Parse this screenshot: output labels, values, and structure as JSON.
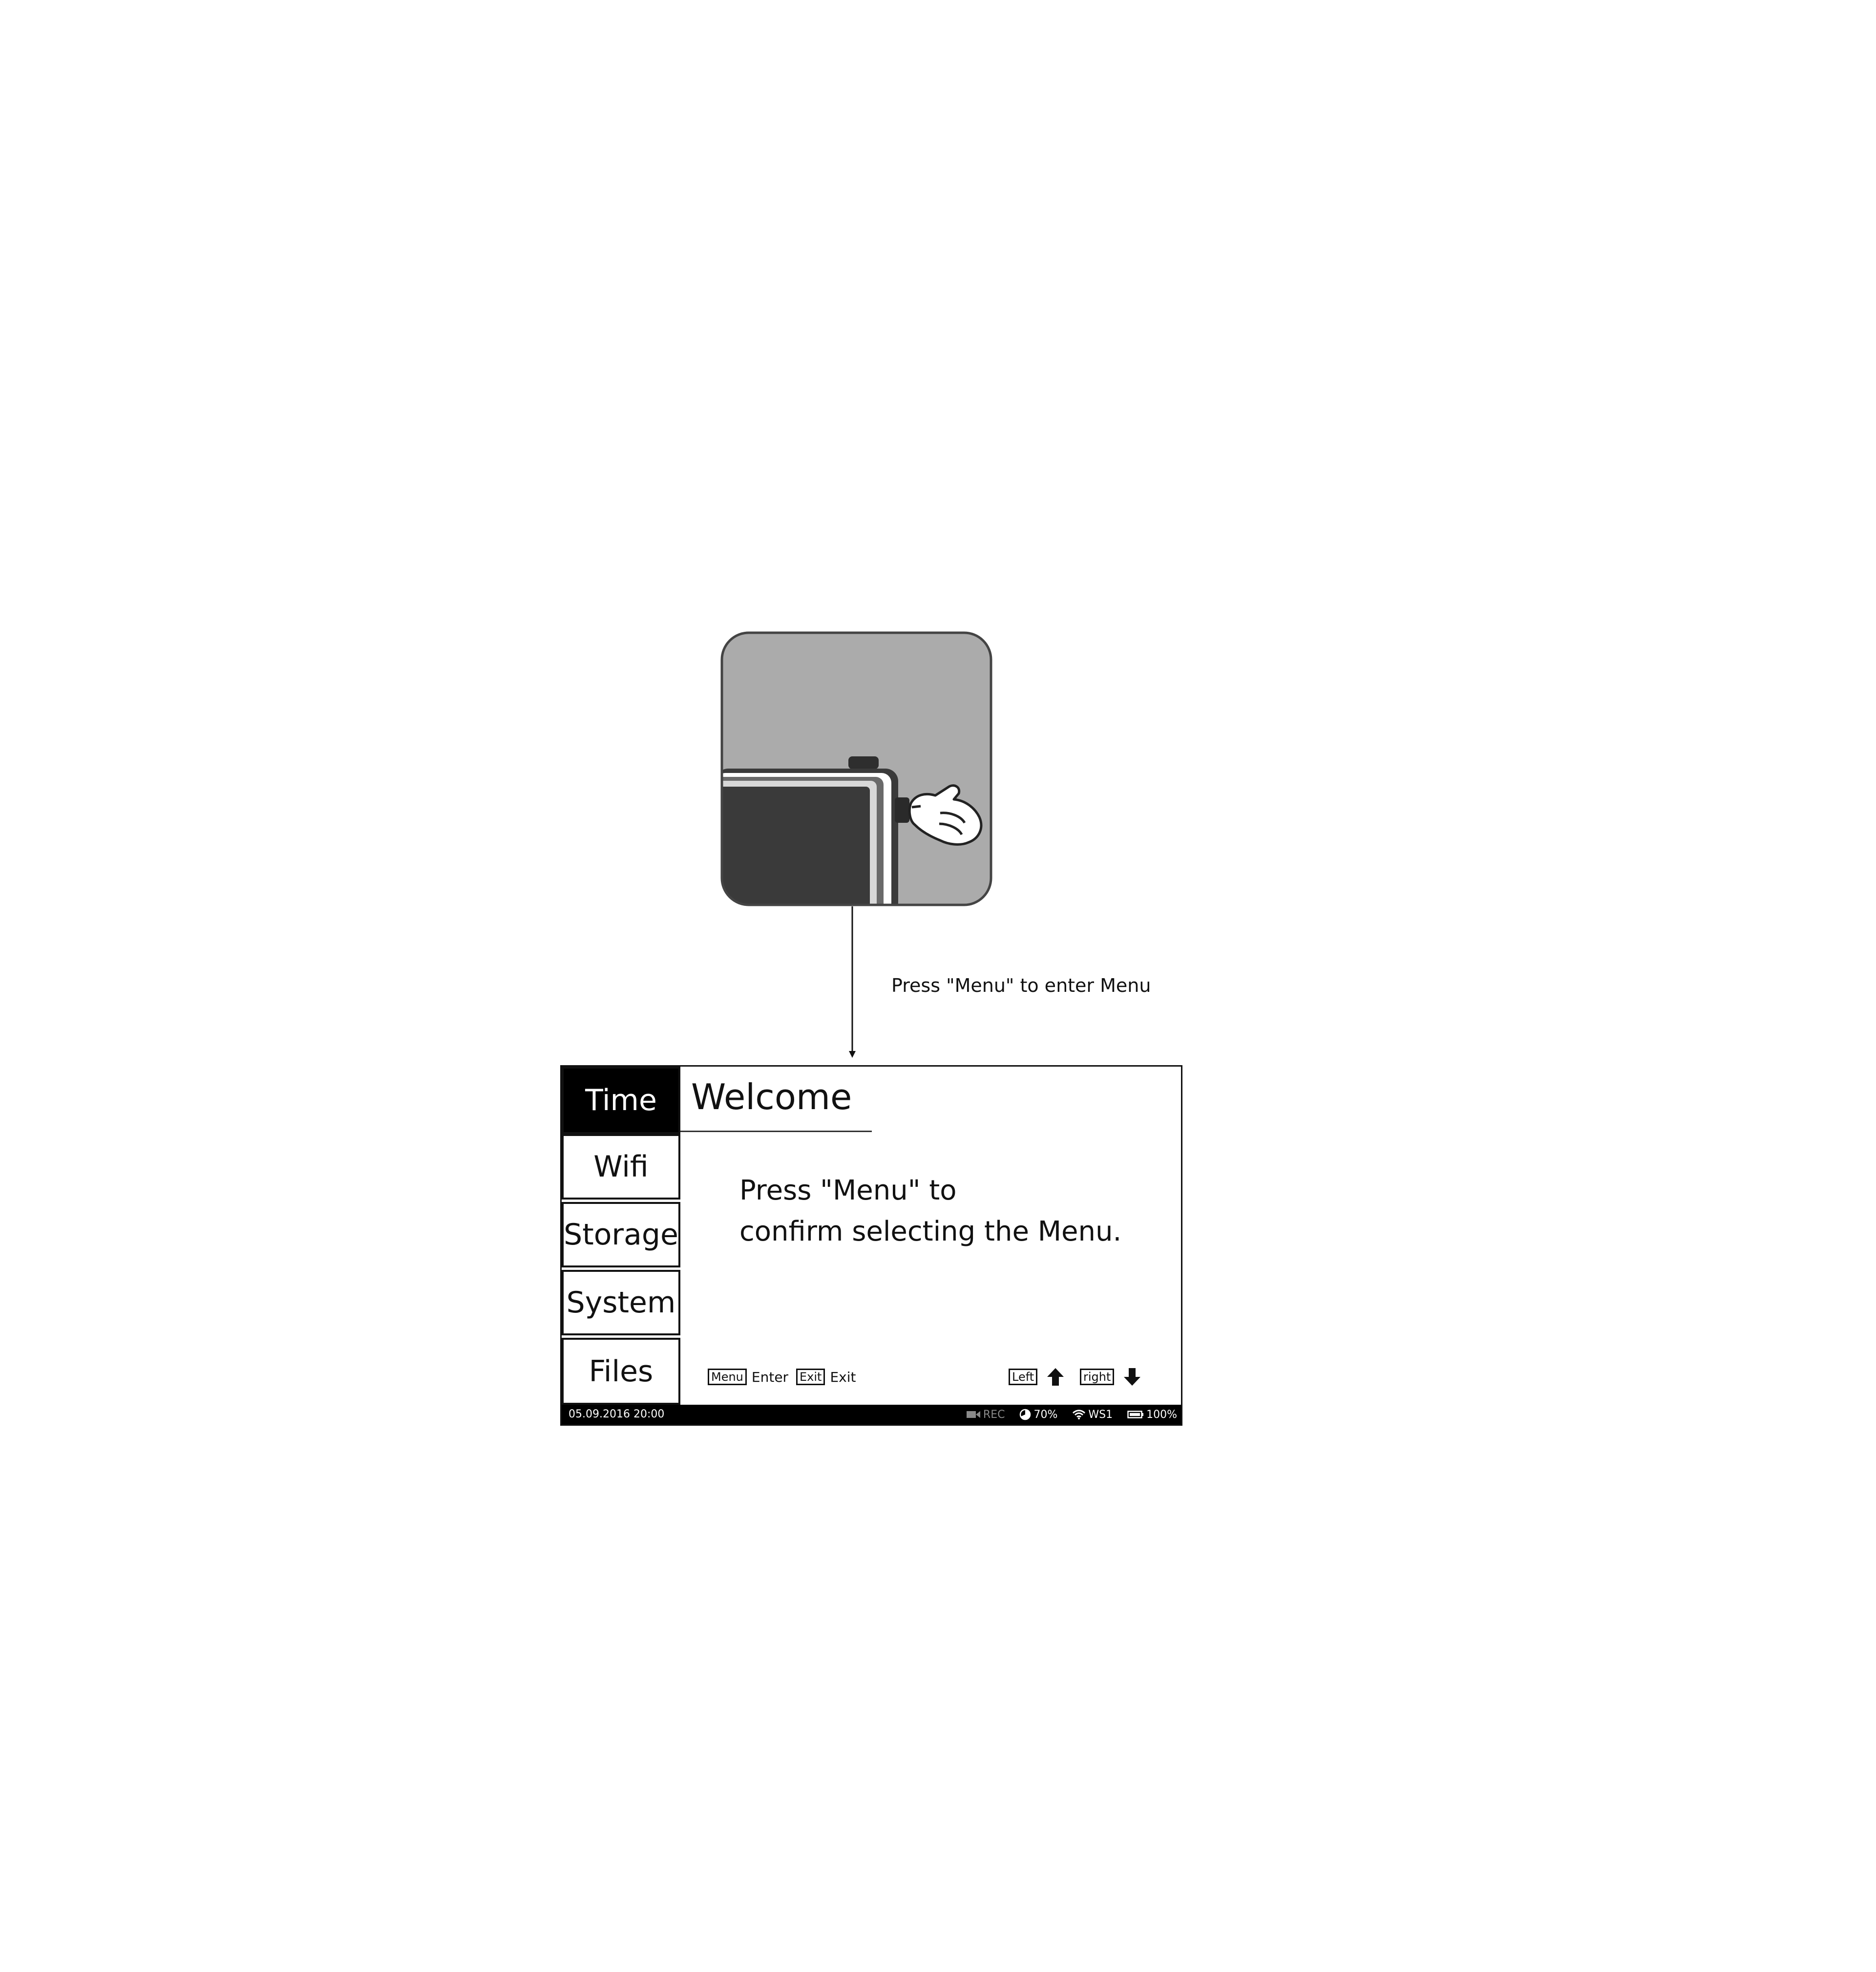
{
  "annotation": "Press \"Menu\" to enter Menu",
  "menu": {
    "items": [
      {
        "label": "Time",
        "active": true
      },
      {
        "label": "Wifi",
        "active": false
      },
      {
        "label": "Storage",
        "active": false
      },
      {
        "label": "System",
        "active": false
      },
      {
        "label": "Files",
        "active": false
      }
    ]
  },
  "content": {
    "title": "Welcome",
    "message_line1": "Press \"Menu\" to",
    "message_line2": "confirm selecting the Menu."
  },
  "hints": {
    "menu_key": "Menu",
    "menu_action": "Enter",
    "exit_key": "Exit",
    "exit_action": "Exit",
    "left_key": "Left",
    "left_icon": "arrow-up-icon",
    "right_key": "right",
    "right_icon": "arrow-down-icon"
  },
  "statusbar": {
    "datetime": "05.09.2016  20:00",
    "rec": "REC",
    "storage": "70%",
    "wifi": "WS1",
    "battery": "100%"
  },
  "colors": {
    "active_bg": "#000000",
    "illustration_bg": "#ababab",
    "device_body": "#3a3a3a"
  }
}
